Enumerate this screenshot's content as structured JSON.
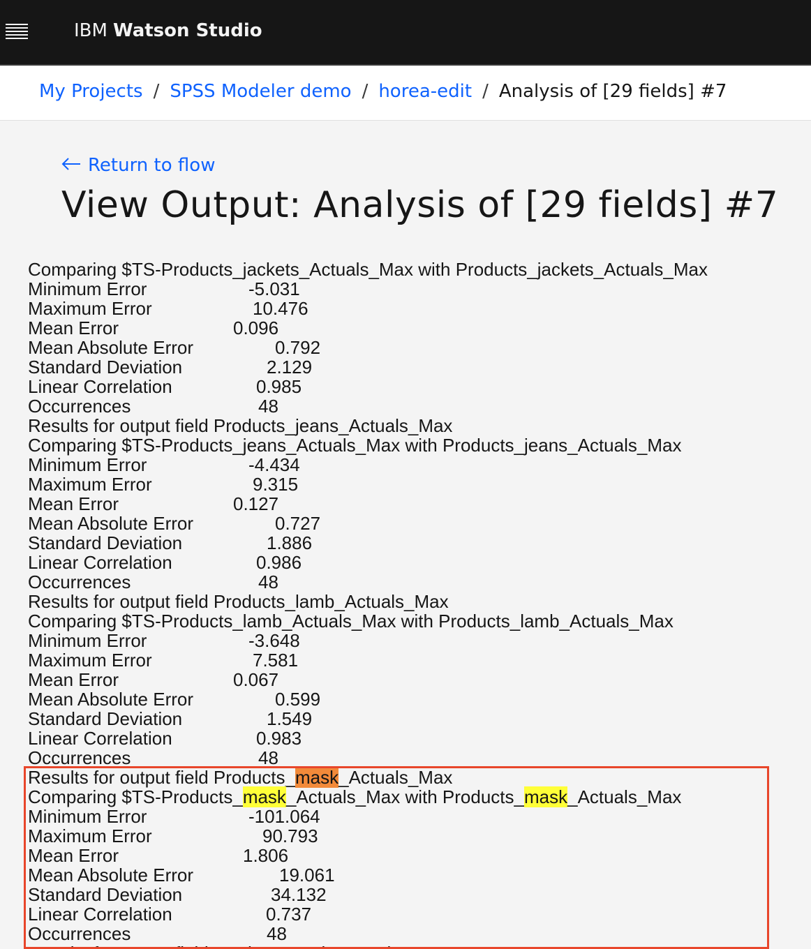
{
  "app": {
    "brand_prefix": "IBM",
    "brand_name": "Watson Studio"
  },
  "breadcrumb": {
    "items": [
      "My Projects",
      "SPSS Modeler demo",
      "horea-edit"
    ],
    "separator": "/",
    "current": "Analysis of [29 fields] #7"
  },
  "back_link": "Return to flow",
  "page_title": "View Output: Analysis of [29 fields] #7",
  "output": {
    "top_line": "Comparing $TS-Products_jackets_Actuals_Max with Products_jackets_Actuals_Max",
    "jackets_stats": [
      {
        "label": "Minimum Error",
        "value": "-5.031"
      },
      {
        "label": "Maximum Error",
        "value": "10.476"
      },
      {
        "label": "Mean Error",
        "value": "0.096"
      },
      {
        "label": "Mean Absolute Error",
        "value": "0.792"
      },
      {
        "label": "Standard Deviation",
        "value": "2.129"
      },
      {
        "label": "Linear Correlation",
        "value": "0.985"
      },
      {
        "label": "Occurrences",
        "value": "48"
      }
    ],
    "jeans": {
      "results": "Results for output field Products_jeans_Actuals_Max",
      "comparing": "Comparing $TS-Products_jeans_Actuals_Max with Products_jeans_Actuals_Max",
      "stats": [
        {
          "label": "Minimum Error",
          "value": "-4.434"
        },
        {
          "label": "Maximum Error",
          "value": "9.315"
        },
        {
          "label": "Mean Error",
          "value": "0.127"
        },
        {
          "label": "Mean Absolute Error",
          "value": "0.727"
        },
        {
          "label": "Standard Deviation",
          "value": "1.886"
        },
        {
          "label": "Linear Correlation",
          "value": "0.986"
        },
        {
          "label": "Occurrences",
          "value": "48"
        }
      ]
    },
    "lamb": {
      "results": "Results for output field Products_lamb_Actuals_Max",
      "comparing": "Comparing $TS-Products_lamb_Actuals_Max with Products_lamb_Actuals_Max",
      "stats": [
        {
          "label": "Minimum Error",
          "value": "-3.648"
        },
        {
          "label": "Maximum Error",
          "value": "7.581"
        },
        {
          "label": "Mean Error",
          "value": "0.067"
        },
        {
          "label": "Mean Absolute Error",
          "value": "0.599"
        },
        {
          "label": "Standard Deviation",
          "value": "1.549"
        },
        {
          "label": "Linear Correlation",
          "value": "0.983"
        },
        {
          "label": "Occurrences",
          "value": "48"
        }
      ]
    },
    "mask": {
      "results_prefix": "Results for output field Products_",
      "highlight_word": "mask",
      "results_suffix": "_Actuals_Max",
      "comparing_prefix": "Comparing $TS-Products_",
      "comparing_middle": "_Actuals_Max with Products_",
      "comparing_suffix": "_Actuals_Max",
      "stats": [
        {
          "label": "Minimum Error",
          "value": "-101.064"
        },
        {
          "label": "Maximum Error",
          "value": "90.793"
        },
        {
          "label": "Mean Error",
          "value": "1.806"
        },
        {
          "label": "Mean Absolute Error",
          "value": "19.061"
        },
        {
          "label": "Standard Deviation",
          "value": "34.132"
        },
        {
          "label": "Linear Correlation",
          "value": "0.737"
        },
        {
          "label": "Occurrences",
          "value": "48"
        }
      ]
    },
    "bottom_line": "Results for output field Products_pork_Actuals_Max"
  },
  "colors": {
    "link": "#0f62fe",
    "highlight": "#ffff38",
    "current_match": "#f28a3a",
    "selection_box": "#e8462b",
    "header_bg": "#161616"
  },
  "icons": [
    "menu-icon",
    "arrow-left-icon"
  ]
}
